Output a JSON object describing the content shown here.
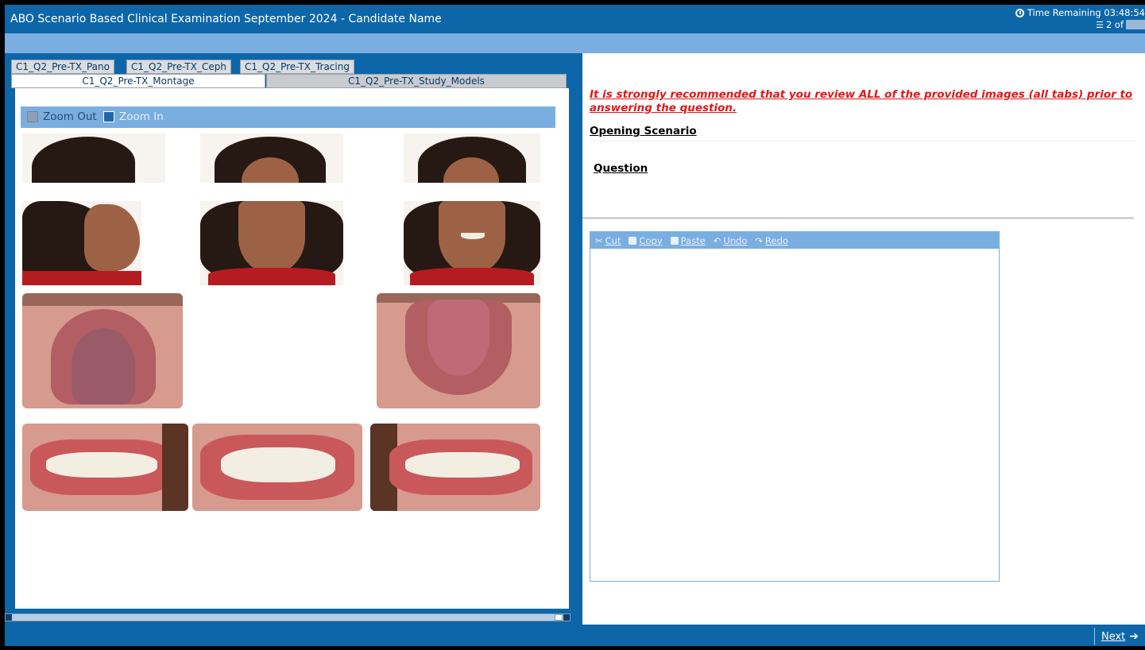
{
  "header": {
    "title": "ABO Scenario Based Clinical Examination September 2024 - Candidate Name",
    "time_label": "Time Remaining 03:48:54",
    "counter_label": "2 of"
  },
  "tabs": {
    "pano": "C1_Q2_Pre-TX_Pano",
    "ceph": "C1_Q2_Pre-TX_Ceph",
    "tracing": "C1_Q2_Pre-TX_Tracing",
    "montage": "C1_Q2_Pre-TX_Montage",
    "study_models": "C1_Q2_Pre-TX_Study_Models"
  },
  "zoom": {
    "zoom_out": "Zoom Out",
    "zoom_in": "Zoom In"
  },
  "right": {
    "warning": "It is strongly recommended that you review ALL of the provided images (all tabs) prior to answering the question.",
    "opening_scenario": "Opening Scenario",
    "question": "Question"
  },
  "editor": {
    "cut": "Cut",
    "copy": "Copy",
    "paste": "Paste",
    "undo": "Undo",
    "redo": "Redo",
    "value": ""
  },
  "footer": {
    "next": "Next"
  },
  "icons": {
    "timer": "clock-icon",
    "counter": "list-icon",
    "zoom_out": "zoom-out-icon",
    "zoom_in": "zoom-in-icon",
    "cut": "scissors-icon",
    "copy": "copy-icon",
    "paste": "paste-icon",
    "undo": "undo-icon",
    "redo": "redo-icon",
    "next": "arrow-right-icon"
  },
  "colors": {
    "header_blue": "#0d66a8",
    "light_blue": "#7aaee1",
    "warning_red": "#e01818"
  }
}
